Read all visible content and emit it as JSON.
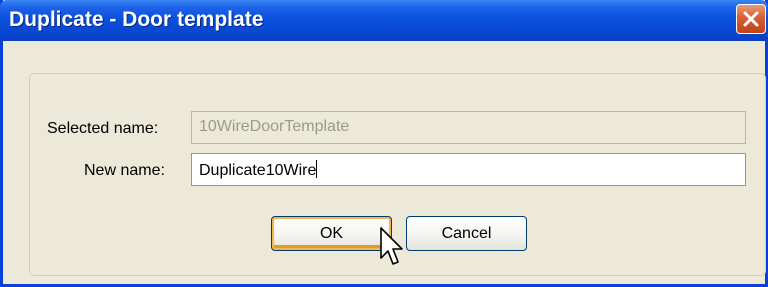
{
  "window": {
    "title": "Duplicate - Door template"
  },
  "form": {
    "selected_name": {
      "label": "Selected name:",
      "value": "10WireDoorTemplate"
    },
    "new_name": {
      "label": "New name:",
      "value": "Duplicate10Wire"
    }
  },
  "buttons": {
    "ok_label": "OK",
    "cancel_label": "Cancel"
  },
  "icons": {
    "close": "close-icon",
    "cursor": "mouse-pointer-icon"
  },
  "colors": {
    "titlebar": "#0a50dc",
    "close_button": "#d65f33",
    "dialog_background": "#ece9d8",
    "default_button_focus": "#f2b64e"
  }
}
